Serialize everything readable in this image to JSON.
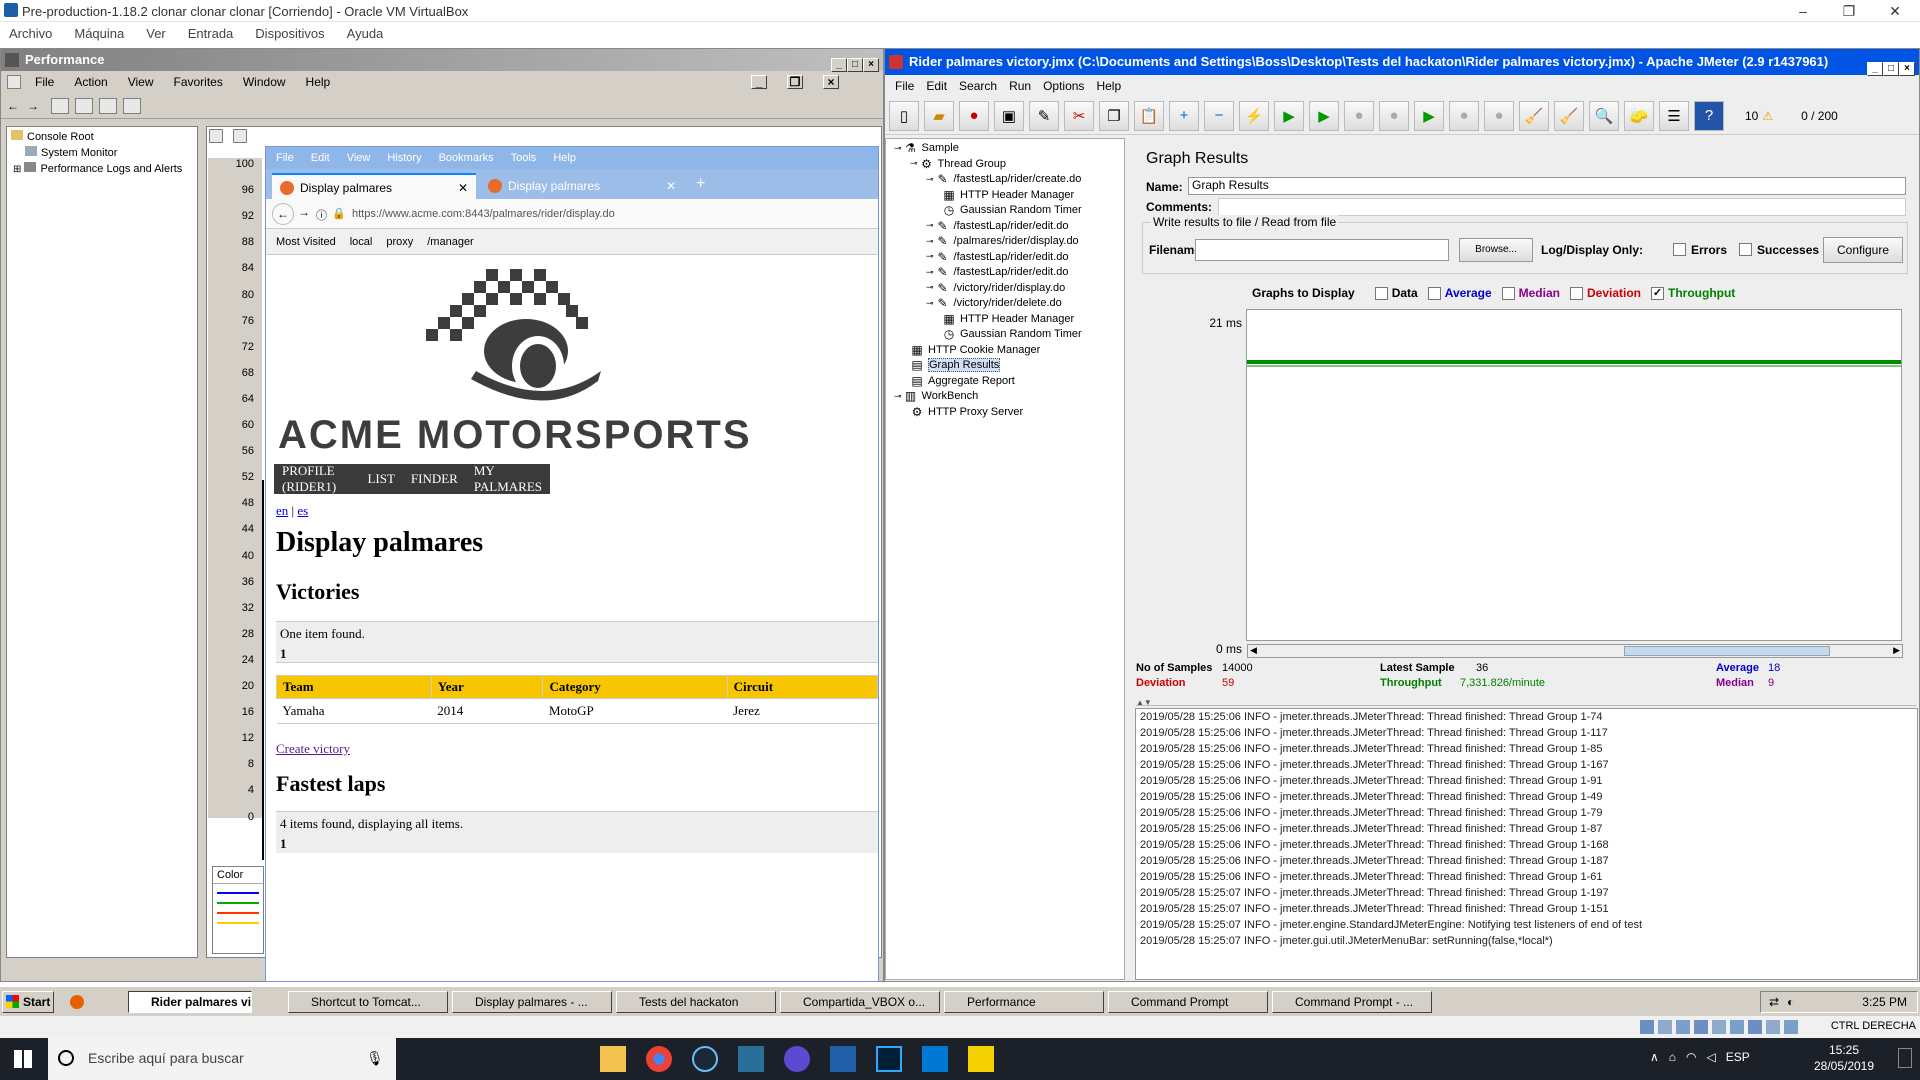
{
  "vbox": {
    "title": "Pre-production-1.18.2 clonar clonar clonar [Corriendo] - Oracle VM VirtualBox",
    "menu": [
      "Archivo",
      "Máquina",
      "Ver",
      "Entrada",
      "Dispositivos",
      "Ayuda"
    ]
  },
  "perf": {
    "title": "Performance",
    "menu": [
      "File",
      "Action",
      "View",
      "Favorites",
      "Window",
      "Help"
    ],
    "tree": [
      "Console Root",
      "System Monitor",
      "Performance Logs and Alerts"
    ],
    "yticks": [
      "100",
      "96",
      "92",
      "88",
      "84",
      "80",
      "76",
      "72",
      "68",
      "64",
      "60",
      "56",
      "52",
      "48",
      "44",
      "40",
      "36",
      "32",
      "28",
      "24",
      "20",
      "16",
      "12",
      "8",
      "4",
      "0"
    ],
    "color_label": "Color"
  },
  "firefox": {
    "menu": [
      "File",
      "Edit",
      "View",
      "History",
      "Bookmarks",
      "Tools",
      "Help"
    ],
    "tabs": [
      "Display palmares",
      "Display palmares"
    ],
    "url": "https://www.acme.com:8443/palmares/rider/display.do",
    "bookmarks": [
      "Most Visited",
      "local",
      "proxy",
      "/manager"
    ],
    "brand": "ACME MOTORSPORTS",
    "nav": [
      "PROFILE (RIDER1)",
      "LIST",
      "FINDER",
      "MY PALMARES"
    ],
    "langs": [
      "en",
      "|",
      "es"
    ],
    "h1": "Display palmares",
    "victories_h": "Victories",
    "victories_found": "One item found.",
    "victories_page": "1",
    "table": {
      "headers": [
        "Team",
        "Year",
        "Category",
        "Circuit"
      ],
      "rows": [
        [
          "Yamaha",
          "2014",
          "MotoGP",
          "Jerez"
        ]
      ]
    },
    "create_link": "Create victory",
    "fastest_h": "Fastest laps",
    "fastest_found": "4 items found, displaying all items.",
    "fastest_page": "1"
  },
  "jmeter": {
    "title": "Rider palmares victory.jmx (C:\\Documents and Settings\\Boss\\Desktop\\Tests del hackaton\\Rider palmares victory.jmx) - Apache JMeter (2.9 r1437961)",
    "menu": [
      "File",
      "Edit",
      "Search",
      "Run",
      "Options",
      "Help"
    ],
    "threads_count": "10",
    "threads_ratio": "0 / 200",
    "tree": [
      {
        "label": "Sample",
        "icon": "flask-icon"
      },
      {
        "label": "Thread Group",
        "icon": "gear-icon"
      },
      {
        "label": "/fastestLap/rider/create.do",
        "icon": "pipette-icon"
      },
      {
        "label": "HTTP Header Manager",
        "icon": "tools-icon"
      },
      {
        "label": "Gaussian Random Timer",
        "icon": "clock-icon"
      },
      {
        "label": "/fastestLap/rider/edit.do",
        "icon": "pipette-icon"
      },
      {
        "label": "/palmares/rider/display.do",
        "icon": "pipette-icon"
      },
      {
        "label": "/fastestLap/rider/edit.do",
        "icon": "pipette-icon"
      },
      {
        "label": "/fastestLap/rider/edit.do",
        "icon": "pipette-icon"
      },
      {
        "label": "/victory/rider/display.do",
        "icon": "pipette-icon"
      },
      {
        "label": "/victory/rider/delete.do",
        "icon": "pipette-icon"
      },
      {
        "label": "HTTP Header Manager",
        "icon": "tools-icon"
      },
      {
        "label": "Gaussian Random Timer",
        "icon": "clock-icon"
      },
      {
        "label": "HTTP Cookie Manager",
        "icon": "tools-icon"
      },
      {
        "label": "Graph Results",
        "icon": "graph-icon"
      },
      {
        "label": "Aggregate Report",
        "icon": "graph-icon"
      },
      {
        "label": "WorkBench",
        "icon": "clipboard-icon"
      },
      {
        "label": "HTTP Proxy Server",
        "icon": "gear-icon"
      }
    ],
    "panel_title": "Graph Results",
    "name_label": "Name:",
    "name_value": "Graph Results",
    "comments_label": "Comments:",
    "file_section": "Write results to file / Read from file",
    "filename_label": "Filename",
    "browse": "Browse...",
    "logdisplay": "Log/Display Only:",
    "errors": "Errors",
    "successes": "Successes",
    "configure": "Configure",
    "graphs_label": "Graphs to Display",
    "graph_opts": [
      {
        "label": "Data",
        "color": "#000000",
        "checked": false
      },
      {
        "label": "Average",
        "color": "#0000cc",
        "checked": false
      },
      {
        "label": "Median",
        "color": "#8b008b",
        "checked": false
      },
      {
        "label": "Deviation",
        "color": "#cc0000",
        "checked": false
      },
      {
        "label": "Throughput",
        "color": "#008000",
        "checked": true
      }
    ],
    "graph_max": "21  ms",
    "graph_min": "0  ms",
    "stats": {
      "samples_label": "No of Samples",
      "samples": "14000",
      "latest_label": "Latest Sample",
      "latest": "36",
      "average_label": "Average",
      "average": "18",
      "deviation_label": "Deviation",
      "deviation": "59",
      "throughput_label": "Throughput",
      "throughput": "7,331.826/minute",
      "median_label": "Median",
      "median": "9"
    },
    "log": [
      "2019/05/28 15:25:06 INFO  - jmeter.threads.JMeterThread: Thread finished: Thread Group 1-74",
      "2019/05/28 15:25:06 INFO  - jmeter.threads.JMeterThread: Thread finished: Thread Group 1-117",
      "2019/05/28 15:25:06 INFO  - jmeter.threads.JMeterThread: Thread finished: Thread Group 1-85",
      "2019/05/28 15:25:06 INFO  - jmeter.threads.JMeterThread: Thread finished: Thread Group 1-167",
      "2019/05/28 15:25:06 INFO  - jmeter.threads.JMeterThread: Thread finished: Thread Group 1-91",
      "2019/05/28 15:25:06 INFO  - jmeter.threads.JMeterThread: Thread finished: Thread Group 1-49",
      "2019/05/28 15:25:06 INFO  - jmeter.threads.JMeterThread: Thread finished: Thread Group 1-79",
      "2019/05/28 15:25:06 INFO  - jmeter.threads.JMeterThread: Thread finished: Thread Group 1-87",
      "2019/05/28 15:25:06 INFO  - jmeter.threads.JMeterThread: Thread finished: Thread Group 1-168",
      "2019/05/28 15:25:06 INFO  - jmeter.threads.JMeterThread: Thread finished: Thread Group 1-187",
      "2019/05/28 15:25:06 INFO  - jmeter.threads.JMeterThread: Thread finished: Thread Group 1-61",
      "2019/05/28 15:25:07 INFO  - jmeter.threads.JMeterThread: Thread finished: Thread Group 1-197",
      "2019/05/28 15:25:07 INFO  - jmeter.threads.JMeterThread: Thread finished: Thread Group 1-151",
      "2019/05/28 15:25:07 INFO  - jmeter.engine.StandardJMeterEngine: Notifying test listeners of end of test",
      "2019/05/28 15:25:07 INFO  - jmeter.gui.util.JMeterMenuBar: setRunning(false,*local*)"
    ]
  },
  "xp_taskbar": {
    "start": "Start",
    "items": [
      "Rider palmares vic...",
      "Shortcut to Tomcat...",
      "Display palmares - ...",
      "Tests del hackaton",
      "Compartida_VBOX o...",
      "Performance",
      "Command Prompt",
      "Command Prompt - ..."
    ],
    "clock": "3:25 PM"
  },
  "vb_status": {
    "host_key": "CTRL DERECHA"
  },
  "win": {
    "search_placeholder": "Escribe aquí para buscar",
    "lang": "ESP",
    "time": "15:25",
    "date": "28/05/2019"
  }
}
